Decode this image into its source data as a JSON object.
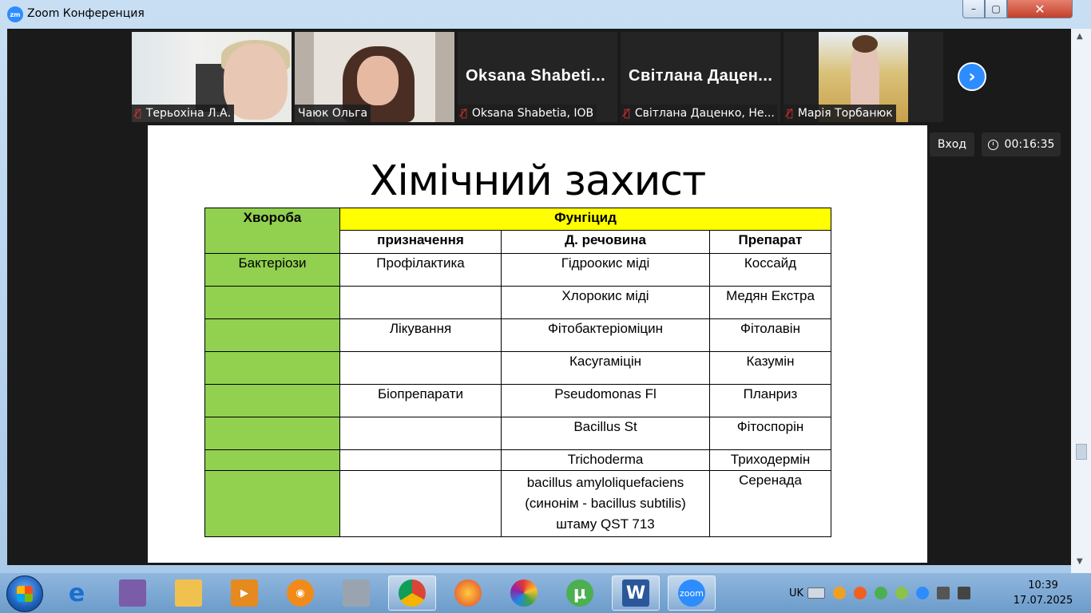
{
  "window": {
    "title": "Zoom Конференция",
    "app_icon_text": "zm",
    "controls": {
      "minimize": "–",
      "maximize": "▢",
      "close": "✕"
    }
  },
  "participants": [
    {
      "name": "Терьохіна Л.А.",
      "muted": true
    },
    {
      "name": "Чаюк Ольга",
      "muted": false,
      "active_speaker": true
    },
    {
      "name": "Oksana Shabetia, IOB",
      "display_label": "Oksana  Shabeti...",
      "muted": true
    },
    {
      "name": "Світлана Даценко, Не...",
      "display_label": "Світлана  Дацен...",
      "muted": true
    },
    {
      "name": "Марія Торбанюк",
      "muted": true
    }
  ],
  "next_icon": "›",
  "overlay": {
    "exit_label": "Вход",
    "timer": "00:16:35"
  },
  "slide": {
    "title": "Хімічний захист",
    "table": {
      "header_col1": "Хвороба",
      "header_group": "Фунгіцид",
      "sub_headers": [
        "призначення",
        "Д. речовина",
        "Препарат"
      ],
      "rows": [
        {
          "disease": "Бактеріози",
          "purpose": "Профілактика",
          "substance": "Гідроокис міді",
          "product": "Коссайд"
        },
        {
          "disease": "",
          "purpose": "",
          "substance": "Хлорокис міді",
          "product": "Медян Екстра"
        },
        {
          "disease": "",
          "purpose": "Лікування",
          "substance": "Фітобактеріоміцин",
          "product": "Фітолавін"
        },
        {
          "disease": "",
          "purpose": "",
          "substance": "Касугаміцін",
          "product": "Казумін"
        },
        {
          "disease": "",
          "purpose": "Біопрепарати",
          "substance": "Pseudomonas Fl",
          "product": "Планриз"
        },
        {
          "disease": "",
          "purpose": "",
          "substance": "Bacillus St",
          "product": "Фітоспорін"
        },
        {
          "disease": "",
          "purpose": "",
          "substance": "Trichoderma",
          "product": "Триходермін"
        },
        {
          "disease": "",
          "purpose": "",
          "substance_lines": [
            "bacillus amyloliquefaciens",
            "(синонім - bacillus subtilis)",
            "штаму QST 713"
          ],
          "product": "Серенада"
        }
      ]
    }
  },
  "taskbar": {
    "items": [
      "start",
      "ie-icon",
      "save-icon",
      "folder-icon",
      "media-icon",
      "security-icon",
      "calculator-icon",
      "chrome-icon",
      "firefox-icon",
      "picasa-icon",
      "utorrent-icon",
      "word-icon",
      "zoom-icon"
    ],
    "zoom_label": "zoom",
    "word_label": "W",
    "utorrent_label": "µ",
    "language": "UK",
    "time": "10:39",
    "date": "17.07.2025"
  },
  "colors": {
    "green_cell": "#92d050",
    "yellow_cell": "#ffff00",
    "zoom_blue": "#2d8cff"
  }
}
